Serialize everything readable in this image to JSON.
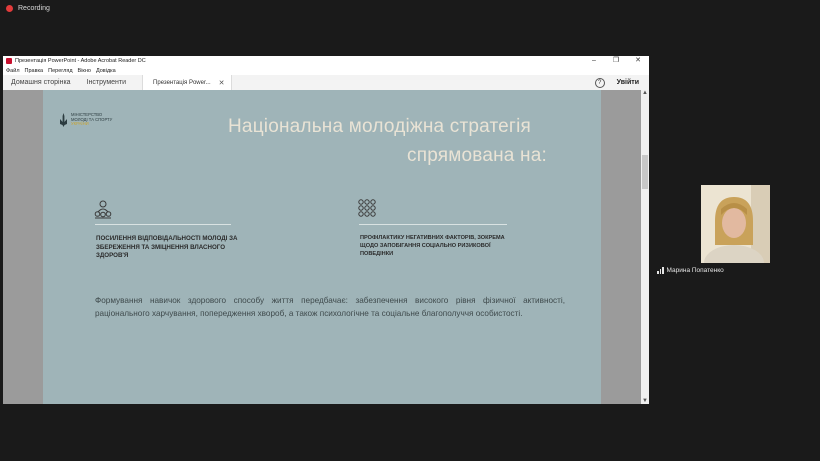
{
  "recording": {
    "label": "Recording"
  },
  "window": {
    "title": "Презентація PowerPoint - Adobe Acrobat Reader DC",
    "controls": {
      "minimize": "–",
      "maximize": "❐",
      "close": "✕"
    }
  },
  "menu": [
    "Файл",
    "Правка",
    "Перегляд",
    "Вікно",
    "Довідка"
  ],
  "tabs": {
    "home": "Домашня сторінка",
    "tools": "Інструменти",
    "document": "Презентація Power...",
    "document_close": "✕",
    "help": "?",
    "login": "Увійти"
  },
  "slide": {
    "logo_lines": [
      "Міністерство",
      "молоді та спорту",
      "України"
    ],
    "title_line1": "Національна молодіжна стратегія",
    "title_line2": "спрямована на:",
    "col1": "Посилення відповідальності молоді за збереження та зміцнення власного здоров'я",
    "col2": "Профілактику негативних факторів, зокрема щодо запобігання соціально ризикової поведінки",
    "paragraph": "Формування навичок здорового способу життя передбачає: забезпечення високого рівня фізичної активності, раціонального харчування, попередження хвороб, а також психологічне та соціальне благополуччя особистості."
  },
  "participant": {
    "name": "Марина Попатенко"
  },
  "colors": {
    "slide_bg": "#9fb4b8",
    "title": "#e9e3d5",
    "rec_dot": "#e23b3b",
    "logo_accent": "#caa42c"
  }
}
